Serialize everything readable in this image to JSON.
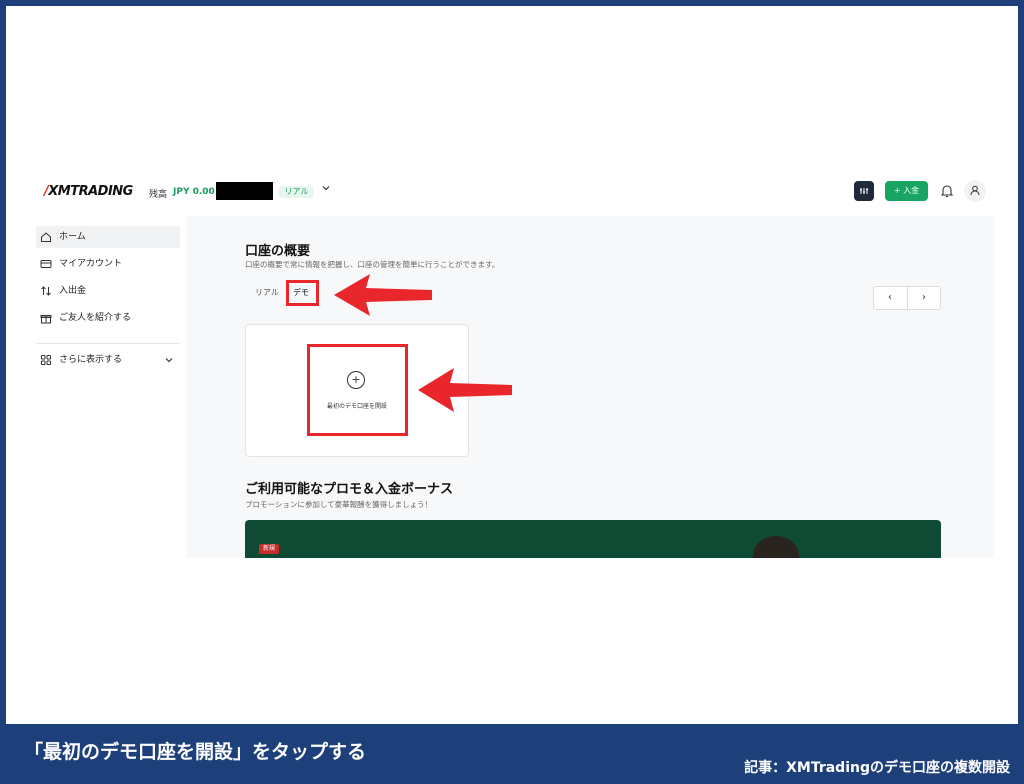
{
  "header": {
    "logo_text": "XMTRADING",
    "balance_label": "残高",
    "balance_value": "JPY 0.00",
    "account_type_badge": "リアル",
    "deposit_button": "+ 入金"
  },
  "sidebar": {
    "items": [
      {
        "label": "ホーム",
        "icon": "home-icon",
        "active": true
      },
      {
        "label": "マイアカウント",
        "icon": "card-icon",
        "active": false
      },
      {
        "label": "入出金",
        "icon": "transfer-icon",
        "active": false
      },
      {
        "label": "ご友人を紹介する",
        "icon": "gift-icon",
        "active": false
      }
    ],
    "more_label": "さらに表示する"
  },
  "main": {
    "title": "口座の概要",
    "subtitle": "口座の概要で常に情報を把握し、口座の管理を簡単に行うことができます。",
    "tabs": [
      {
        "label": "リアル"
      },
      {
        "label": "デモ"
      }
    ],
    "pager": {
      "prev": "‹",
      "next": "›"
    },
    "open_demo": {
      "plus": "+",
      "label": "最初のデモ口座を開設"
    },
    "promo": {
      "title": "ご利用可能なプロモ＆入金ボーナス",
      "subtitle": "プロモーションに参加して豪華報酬を獲得しましょう！",
      "tag": "新規"
    }
  },
  "annotation_color": "#e8262b",
  "caption": {
    "text": "「最初のデモ口座を開設」をタップする",
    "credit": "記事：XMTradingのデモ口座の複数開設"
  }
}
